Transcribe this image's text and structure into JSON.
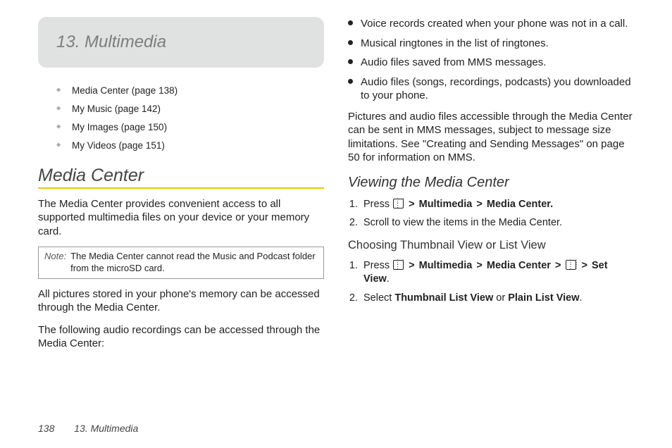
{
  "chapter": {
    "title": "13. Multimedia"
  },
  "toc": [
    "Media Center (page 138)",
    "My Music (page 142)",
    "My Images (page 150)",
    "My Videos (page 151)"
  ],
  "left": {
    "section_title": "Media Center",
    "intro": "The Media Center provides convenient access to all supported multimedia files on your device or your memory card.",
    "note_label": "Note:",
    "note_text": "The Media Center cannot read the Music and Podcast folder from the microSD card.",
    "p2": "All pictures stored in your phone's memory can be accessed through the Media Center.",
    "p3": "The following audio recordings can be accessed through the Media Center:"
  },
  "right": {
    "bullets": [
      "Voice records created when your phone was not in a call.",
      "Musical ringtones in the list of ringtones.",
      "Audio files saved from MMS messages.",
      "Audio files (songs, recordings, podcasts) you downloaded to your phone."
    ],
    "mms_para": "Pictures and audio files accessible through the Media Center can be sent in MMS messages, subject to message size limitations. See \"Creating and Sending Messages\" on page 50 for information on MMS.",
    "sub1_title": "Viewing the Media Center",
    "sub1_steps": {
      "s1_pre": "Press ",
      "s1_b1": "Multimedia",
      "s1_b2": "Media Center.",
      "s2": "Scroll to view the items in the Media Center."
    },
    "sub2_title": "Choosing Thumbnail View or List View",
    "sub2_steps": {
      "s1_pre": "Press ",
      "s1_b1": "Multimedia",
      "s1_b2": "Media Center",
      "s1_b3": "Set View",
      "s2_pre": "Select ",
      "s2_b1": "Thumbnail List View",
      "s2_mid": " or ",
      "s2_b2": "Plain List View",
      "s2_post": "."
    }
  },
  "footer": {
    "page": "138",
    "title": "13. Multimedia"
  },
  "gt": ">"
}
